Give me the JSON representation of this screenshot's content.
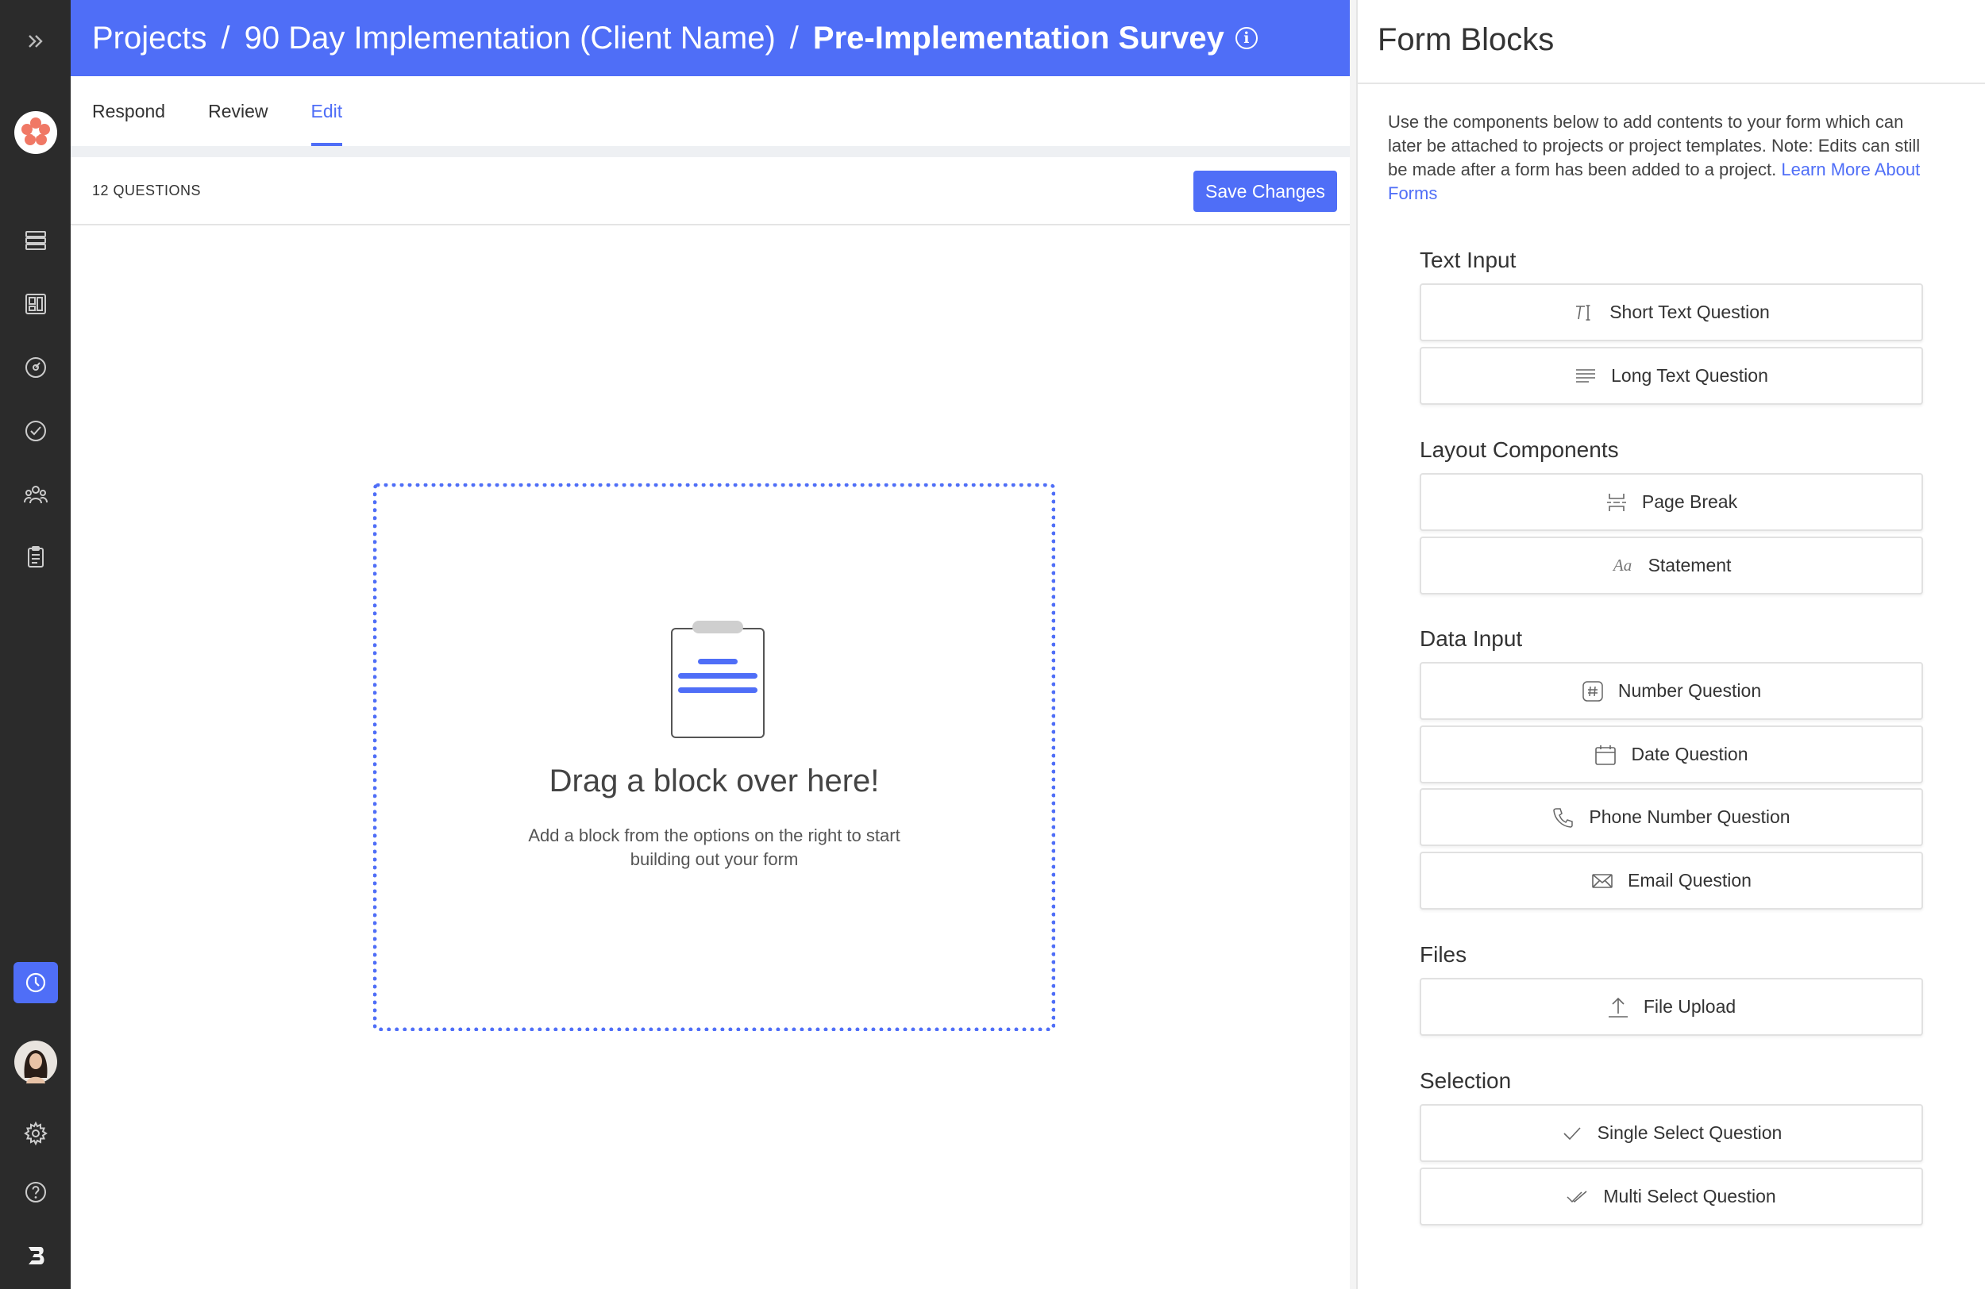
{
  "breadcrumb": {
    "items": [
      "Projects",
      "90 Day Implementation (Client Name)",
      "Pre-Implementation Survey"
    ],
    "separator": "/",
    "info_glyph": "i"
  },
  "tabs": [
    {
      "label": "Respond",
      "active": false
    },
    {
      "label": "Review",
      "active": false
    },
    {
      "label": "Edit",
      "active": true
    }
  ],
  "toolbar": {
    "question_count": "12 QUESTIONS",
    "save_label": "Save Changes"
  },
  "dropzone": {
    "title": "Drag a block over here!",
    "subtitle": "Add a block from the options on the right to start building out your form"
  },
  "sidebar": {
    "icons": [
      "expand-chevrons-icon",
      "brand-flower-logo",
      "list-icon",
      "board-icon",
      "dashboard-icon",
      "check-circle-icon",
      "people-icon",
      "clipboard-icon",
      "clock-icon",
      "avatar",
      "gear-icon",
      "help-icon",
      "bolt-logo"
    ],
    "active": "clock-icon"
  },
  "panel": {
    "title": "Form Blocks",
    "description": "Use the components below to add contents to your form which can later be attached to projects or project templates. Note: Edits can still be made after a form has been added to a project.",
    "learn_more": "Learn More About Forms",
    "groups": [
      {
        "title": "Text Input",
        "blocks": [
          {
            "label": "Short Text Question",
            "icon": "text-cursor-icon"
          },
          {
            "label": "Long Text Question",
            "icon": "paragraph-lines-icon"
          }
        ]
      },
      {
        "title": "Layout Components",
        "blocks": [
          {
            "label": "Page Break",
            "icon": "page-break-icon"
          },
          {
            "label": "Statement",
            "icon": "font-aa-icon",
            "glyph": "Aa"
          }
        ]
      },
      {
        "title": "Data Input",
        "blocks": [
          {
            "label": "Number Question",
            "icon": "hash-icon"
          },
          {
            "label": "Date Question",
            "icon": "calendar-icon"
          },
          {
            "label": "Phone Number Question",
            "icon": "phone-icon"
          },
          {
            "label": "Email Question",
            "icon": "envelope-icon"
          }
        ]
      },
      {
        "title": "Files",
        "blocks": [
          {
            "label": "File Upload",
            "icon": "upload-icon"
          }
        ]
      },
      {
        "title": "Selection",
        "blocks": [
          {
            "label": "Single Select Question",
            "icon": "check-icon"
          },
          {
            "label": "Multi Select Question",
            "icon": "double-check-icon"
          }
        ]
      }
    ]
  },
  "colors": {
    "accent": "#4f6ef7",
    "rail": "#2b2b2b",
    "brand_logo": "#f07865"
  }
}
